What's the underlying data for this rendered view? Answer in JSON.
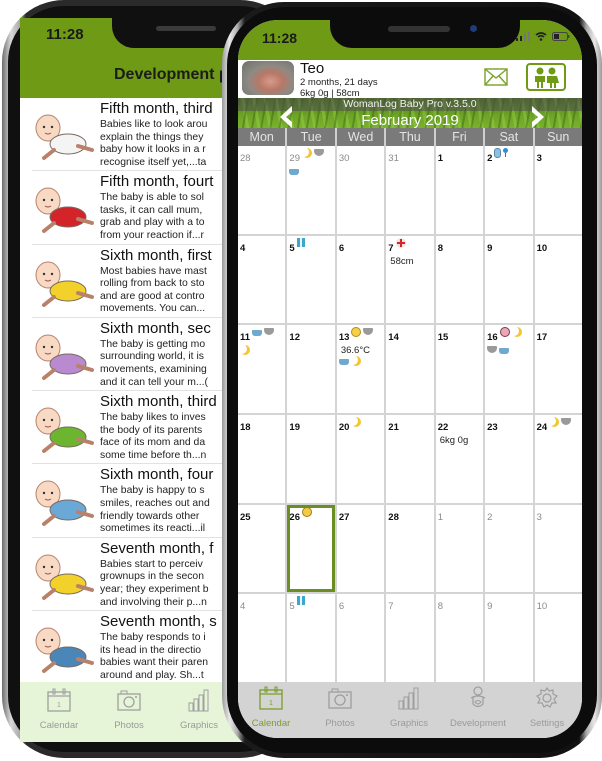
{
  "back_phone": {
    "status_time": "11:28",
    "header_title": "Development p",
    "items": [
      {
        "title": "Fifth month, third",
        "desc": [
          "Babies like to look arou",
          "explain the things they",
          "baby how it looks in a r",
          "recognise itself yet,...ta"
        ]
      },
      {
        "title": "Fifth month, fourt",
        "desc": [
          "The baby is able to sol",
          "tasks, it can call mum,",
          "grab and play with a to",
          "from your reaction if...r"
        ]
      },
      {
        "title": "Sixth month, first",
        "desc": [
          "Most babies have mast",
          "rolling from back to sto",
          "and are good at contro",
          "movements. You can..."
        ]
      },
      {
        "title": "Sixth month, sec",
        "desc": [
          "The baby is getting mo",
          "surrounding world, it is",
          "movements, examining",
          "and it can tell your m...("
        ]
      },
      {
        "title": "Sixth month, third",
        "desc": [
          "The baby likes to inves",
          "the body of its parents",
          "face of its mom and da",
          "some time before th...n"
        ]
      },
      {
        "title": "Sixth month, four",
        "desc": [
          "The baby is happy to s",
          "smiles, reaches out and",
          "friendly towards other",
          "sometimes its reacti...il"
        ]
      },
      {
        "title": "Seventh month, f",
        "desc": [
          "Babies start to perceiv",
          "grownups in the secon",
          "year; they experiment b",
          "and involving their p...n"
        ]
      },
      {
        "title": "Seventh month, s",
        "desc": [
          "The baby responds to i",
          "its head in the directio",
          "babies want their paren",
          "around and play. Sh...t"
        ]
      }
    ],
    "tabs": [
      {
        "label": "Calendar",
        "icon": "calendar-icon"
      },
      {
        "label": "Photos",
        "icon": "camera-icon"
      },
      {
        "label": "Graphics",
        "icon": "bar-chart-icon"
      }
    ]
  },
  "front_phone": {
    "status_time": "11:28",
    "child": {
      "name": "Teo",
      "age": "2 months, 21 days",
      "stats": "6kg 0g | 58cm"
    },
    "app_version": "WomanLog Baby Pro v.3.5.0",
    "month_title": "February 2019",
    "weekdays": [
      "Mon",
      "Tue",
      "Wed",
      "Thu",
      "Fri",
      "Sat",
      "Sun"
    ],
    "accent_color": "#6e9a16",
    "weeks": [
      [
        {
          "day": "28",
          "other": true,
          "icons": []
        },
        {
          "day": "29",
          "other": true,
          "icons": [
            "moon",
            "diaper",
            "bath"
          ]
        },
        {
          "day": "30",
          "other": true,
          "icons": []
        },
        {
          "day": "31",
          "other": true,
          "icons": []
        },
        {
          "day": "1",
          "icons": []
        },
        {
          "day": "2",
          "icons": [
            "bottle",
            "pin"
          ]
        },
        {
          "day": "3",
          "icons": []
        }
      ],
      [
        {
          "day": "4",
          "icons": []
        },
        {
          "day": "5",
          "icons": [
            "gift"
          ]
        },
        {
          "day": "6",
          "icons": []
        },
        {
          "day": "7",
          "icons": [
            "cross"
          ],
          "note": "58cm"
        },
        {
          "day": "8",
          "icons": []
        },
        {
          "day": "9",
          "icons": []
        },
        {
          "day": "10",
          "icons": []
        }
      ],
      [
        {
          "day": "11",
          "icons": [
            "bath",
            "diaper",
            "moon"
          ]
        },
        {
          "day": "12",
          "icons": []
        },
        {
          "day": "13",
          "icons": [
            "smile",
            "diaper"
          ],
          "note": "36.6°C",
          "icons_after": [
            "bath",
            "moon"
          ]
        },
        {
          "day": "14",
          "icons": []
        },
        {
          "day": "15",
          "icons": []
        },
        {
          "day": "16",
          "icons": [
            "cry",
            "moon",
            "diaper",
            "bath"
          ]
        },
        {
          "day": "17",
          "icons": []
        }
      ],
      [
        {
          "day": "18",
          "icons": []
        },
        {
          "day": "19",
          "icons": []
        },
        {
          "day": "20",
          "icons": [
            "moon"
          ]
        },
        {
          "day": "21",
          "icons": []
        },
        {
          "day": "22",
          "icons": [],
          "note": "6kg 0g"
        },
        {
          "day": "23",
          "icons": []
        },
        {
          "day": "24",
          "icons": [
            "moon",
            "diaper"
          ]
        }
      ],
      [
        {
          "day": "25",
          "icons": []
        },
        {
          "day": "26",
          "icons": [
            "face-q"
          ],
          "selected": true
        },
        {
          "day": "27",
          "icons": []
        },
        {
          "day": "28",
          "icons": []
        },
        {
          "day": "1",
          "other": true,
          "icons": []
        },
        {
          "day": "2",
          "other": true,
          "icons": []
        },
        {
          "day": "3",
          "other": true,
          "icons": []
        }
      ],
      [
        {
          "day": "4",
          "other": true,
          "icons": []
        },
        {
          "day": "5",
          "other": true,
          "icons": [
            "gift"
          ]
        },
        {
          "day": "6",
          "other": true,
          "icons": []
        },
        {
          "day": "7",
          "other": true,
          "icons": []
        },
        {
          "day": "8",
          "other": true,
          "icons": []
        },
        {
          "day": "9",
          "other": true,
          "icons": []
        },
        {
          "day": "10",
          "other": true,
          "icons": []
        }
      ]
    ],
    "tabs": [
      {
        "label": "Calendar",
        "icon": "calendar-icon",
        "active": true
      },
      {
        "label": "Photos",
        "icon": "camera-icon"
      },
      {
        "label": "Graphics",
        "icon": "bar-chart-icon"
      },
      {
        "label": "Development",
        "icon": "baby-icon"
      },
      {
        "label": "Settings",
        "icon": "gear-icon"
      }
    ]
  }
}
